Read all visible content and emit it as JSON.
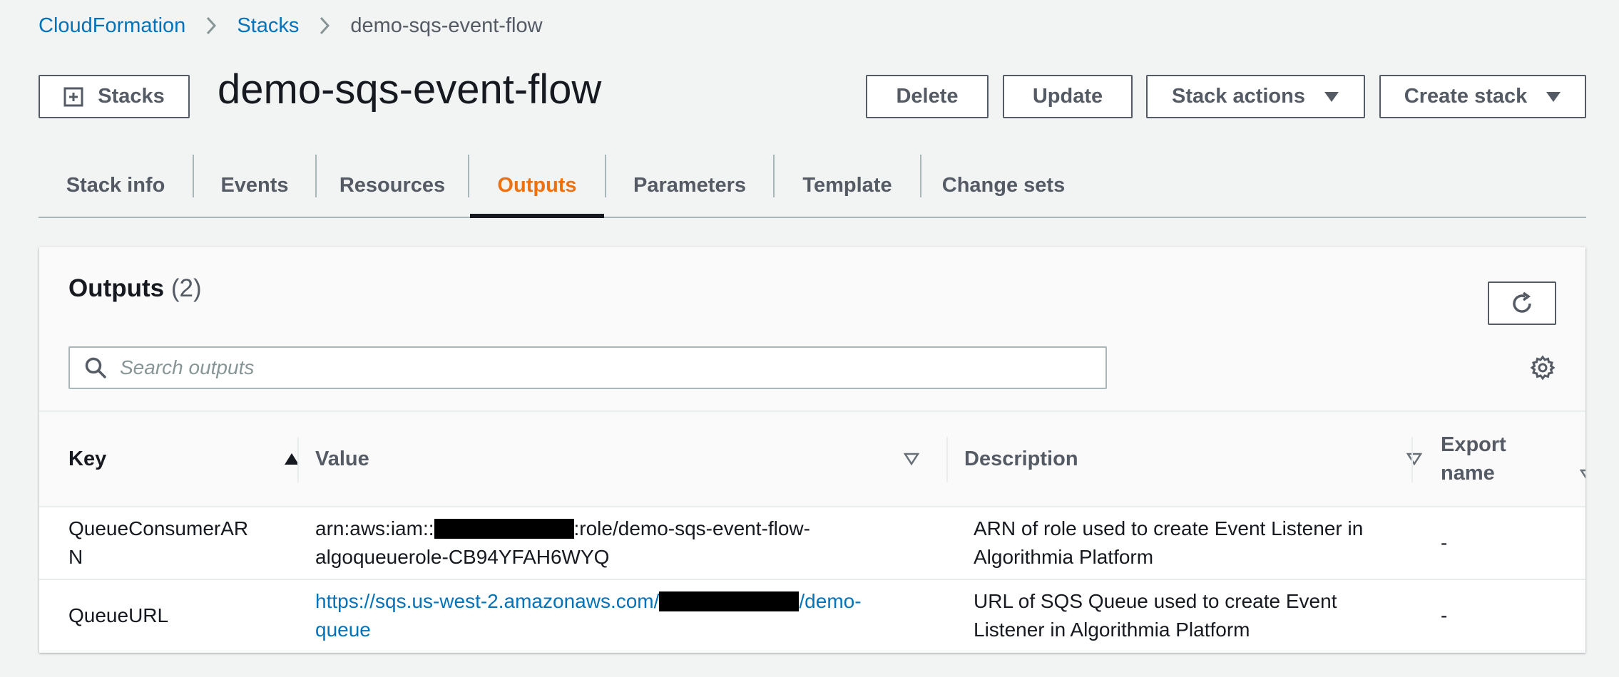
{
  "breadcrumb": {
    "items": [
      {
        "label": "CloudFormation"
      },
      {
        "label": "Stacks"
      }
    ],
    "current": "demo-sqs-event-flow"
  },
  "header": {
    "stacks_button_label": "Stacks",
    "title": "demo-sqs-event-flow",
    "actions": {
      "delete": "Delete",
      "update": "Update",
      "stack_actions": "Stack actions",
      "create_stack": "Create stack"
    }
  },
  "tabs": [
    {
      "label": "Stack info"
    },
    {
      "label": "Events"
    },
    {
      "label": "Resources"
    },
    {
      "label": "Outputs",
      "active": true
    },
    {
      "label": "Parameters"
    },
    {
      "label": "Template"
    },
    {
      "label": "Change sets"
    }
  ],
  "outputs": {
    "title": "Outputs",
    "count": "(2)",
    "search_placeholder": "Search outputs",
    "columns": {
      "key": "Key",
      "value": "Value",
      "description": "Description",
      "export_name_line1": "Export",
      "export_name_line2": "name"
    },
    "rows": [
      {
        "key_line1": "QueueConsumerAR",
        "key_line2": "N",
        "value_prefix": "arn:aws:iam::",
        "value_suffix": ":role/demo-sqs-event-flow-",
        "value_line2": "algoqueuerole-CB94YFAH6WYQ",
        "description_line1": "ARN of role used to create Event Listener in",
        "description_line2": "Algorithmia Platform",
        "export_name": "-"
      },
      {
        "key": "QueueURL",
        "value_prefix": "https://sqs.us-west-2.amazonaws.com/",
        "value_suffix": "/demo-",
        "value_line2": "queue",
        "description_line1": "URL of SQS Queue used to create Event",
        "description_line2": "Listener in Algorithmia Platform",
        "export_name": "-"
      }
    ]
  },
  "colors": {
    "link": "#0073bb",
    "active_tab": "#ec7211",
    "text": "#16191f",
    "muted": "#545b64",
    "background": "#f2f3f3"
  },
  "icons": {
    "breadcrumb_separator": "chevron-right-icon",
    "stacks_button": "plus-square-icon",
    "dropdown": "caret-down-icon",
    "refresh": "refresh-icon",
    "search": "search-icon",
    "settings": "gear-icon",
    "sort_ascending": "sort-asc-icon",
    "sort_unsorted": "sort-neutral-icon"
  }
}
